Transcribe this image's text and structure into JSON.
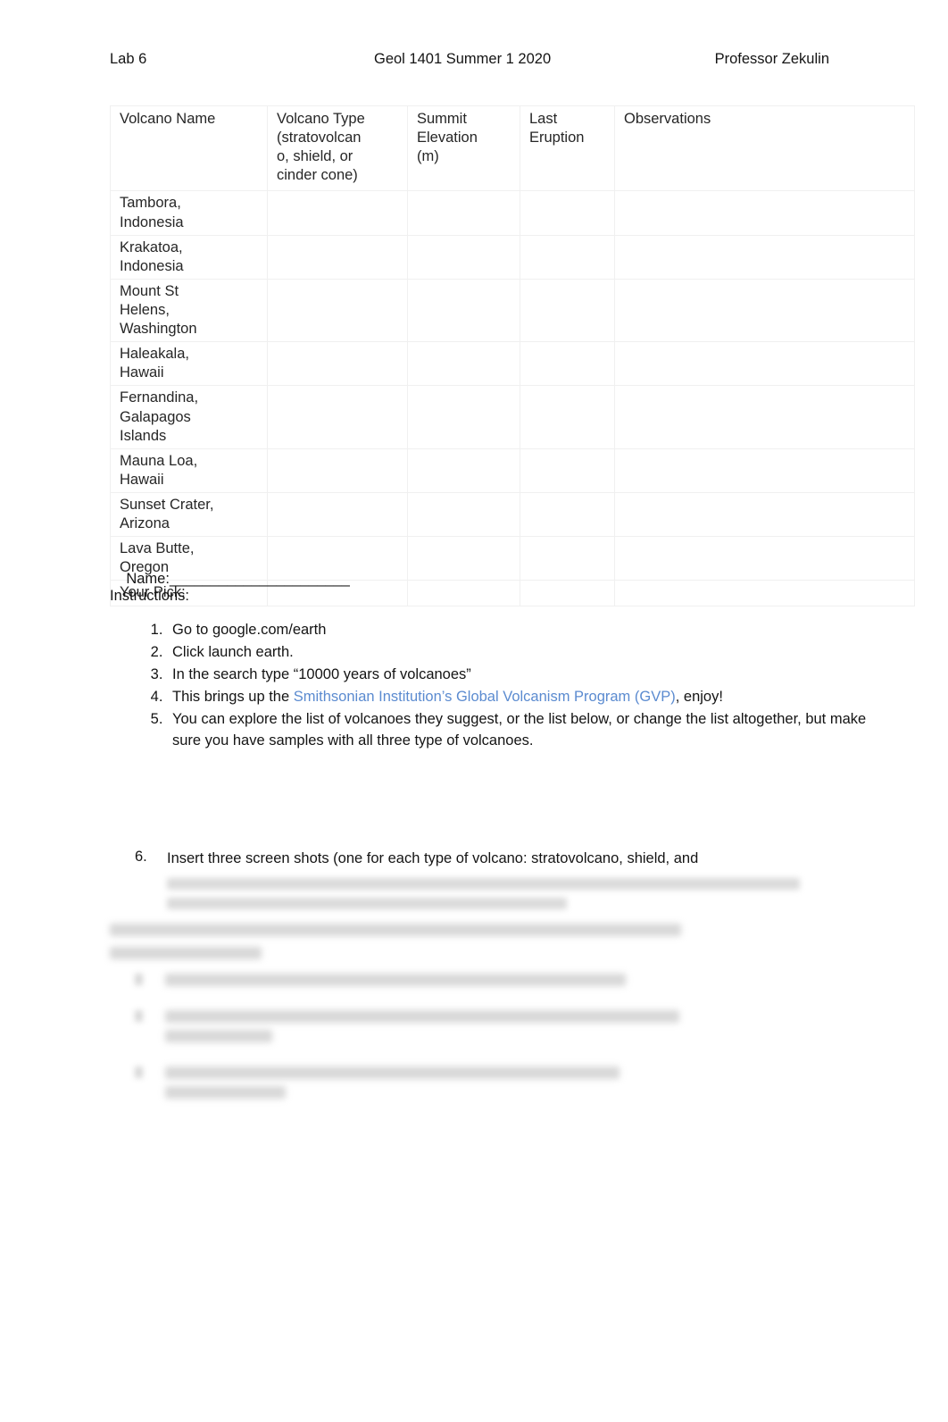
{
  "header": {
    "left": "Lab 6",
    "center": "Geol 1401 Summer 1 2020",
    "right": "Professor Zekulin"
  },
  "table": {
    "columns": [
      {
        "label": "Volcano Name",
        "sub": ""
      },
      {
        "label": "Volcano Type",
        "sub": "(stratovolcano, shield, or cinder cone)"
      },
      {
        "label": "Summit Elevation",
        "sub": "(m)"
      },
      {
        "label": "Last Eruption",
        "sub": ""
      },
      {
        "label": "Observations",
        "sub": ""
      }
    ],
    "col_type_line1": "Volcano Type",
    "col_type_line2": "(stratovolcan",
    "col_type_line3": "o, shield, or",
    "col_type_line4": "cinder cone)",
    "col_elev_line1": "Summit",
    "col_elev_line2": "Elevation",
    "col_elev_line3": "(m)",
    "col_last_line1": "Last",
    "col_last_line2": "Eruption",
    "rows": [
      {
        "name_line1": "Tambora,",
        "name_line2": "Indonesia",
        "name_line3": "",
        "type": "",
        "elevation": "",
        "last_eruption": "",
        "observations": ""
      },
      {
        "name_line1": "Krakatoa,",
        "name_line2": "Indonesia",
        "name_line3": "",
        "type": "",
        "elevation": "",
        "last_eruption": "",
        "observations": ""
      },
      {
        "name_line1": "Mount St",
        "name_line2": "Helens,",
        "name_line3": "Washington",
        "type": "",
        "elevation": "",
        "last_eruption": "",
        "observations": ""
      },
      {
        "name_line1": "Haleakala,",
        "name_line2": "Hawaii",
        "name_line3": "",
        "type": "",
        "elevation": "",
        "last_eruption": "",
        "observations": ""
      },
      {
        "name_line1": "Fernandina,",
        "name_line2": "Galapagos",
        "name_line3": "Islands",
        "type": "",
        "elevation": "",
        "last_eruption": "",
        "observations": ""
      },
      {
        "name_line1": "Mauna Loa,",
        "name_line2": "Hawaii",
        "name_line3": "",
        "type": "",
        "elevation": "",
        "last_eruption": "",
        "observations": ""
      },
      {
        "name_line1": "Sunset Crater,",
        "name_line2": "Arizona",
        "name_line3": "",
        "type": "",
        "elevation": "",
        "last_eruption": "",
        "observations": ""
      },
      {
        "name_line1": "Lava Butte,",
        "name_line2": "Oregon",
        "name_line3": "",
        "type": "",
        "elevation": "",
        "last_eruption": "",
        "observations": ""
      },
      {
        "name_line1": "Your Pick:",
        "name_line2": "",
        "name_line3": "",
        "type": "",
        "elevation": "",
        "last_eruption": "",
        "observations": ""
      }
    ]
  },
  "name_field": {
    "label": "Name:",
    "blank": "______________________"
  },
  "instructions": {
    "heading": "Instructions:",
    "items": [
      {
        "text": "Go to google.com/earth"
      },
      {
        "text": "Click launch earth."
      },
      {
        "text": "In the search type “10000 years of volcanoes”"
      },
      {
        "prefix": "This brings up the ",
        "link_text": "Smithsonian Institution’s Global Volcanism Program (GVP)",
        "suffix": ", enjoy!"
      },
      {
        "text": "You can explore the list of volcanoes they suggest, or the list below, or change the list altogether, but make sure you have samples with all three type of volcanoes."
      }
    ],
    "item6": {
      "number": "6.",
      "text": "Insert three screen shots (one for each type of volcano: stratovolcano, shield, and"
    }
  },
  "colors": {
    "link": "#5b8bd0",
    "text": "#141414",
    "table_border": "#f0f0f0",
    "page_background": "#ffffff"
  }
}
